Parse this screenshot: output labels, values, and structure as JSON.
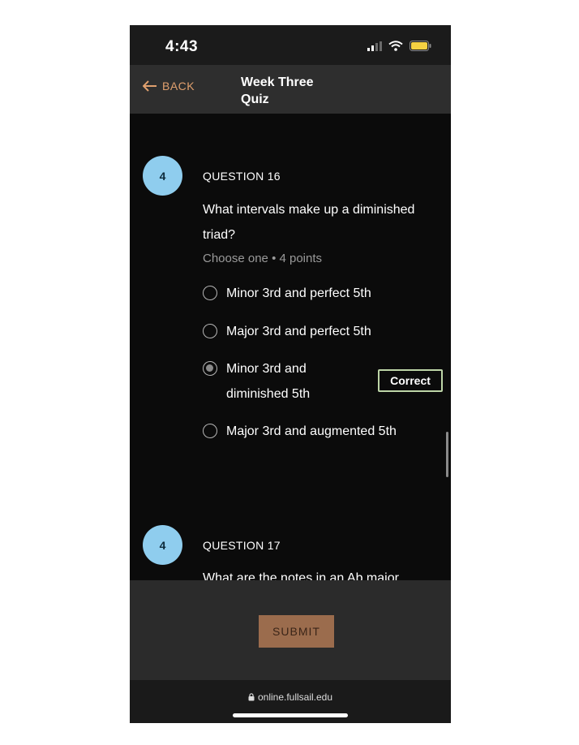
{
  "status_bar": {
    "time": "4:43"
  },
  "nav": {
    "back_label": "BACK",
    "title": "Week Three Quiz"
  },
  "questions": [
    {
      "badge": "4",
      "number": "QUESTION 16",
      "text": "What intervals make up a diminished triad?",
      "meta": "Choose one • 4 points",
      "options": [
        {
          "label": "Minor 3rd and perfect 5th",
          "selected": false
        },
        {
          "label": "Major 3rd and perfect 5th",
          "selected": false
        },
        {
          "label": "Minor 3rd and diminished 5th",
          "selected": true
        },
        {
          "label": "Major 3rd and augmented 5th",
          "selected": false
        }
      ],
      "result": "Correct"
    },
    {
      "badge": "4",
      "number": "QUESTION 17",
      "text": "What are the notes in an Ab major"
    }
  ],
  "footer": {
    "submit_label": "SUBMIT"
  },
  "browser": {
    "url": "online.fullsail.edu"
  },
  "colors": {
    "accent": "#e0a06e",
    "badge": "#8fcdee",
    "submit_bg": "#9b6c4d",
    "correct_border": "#bdd5a7"
  },
  "icons": [
    "signal-icon",
    "wifi-icon",
    "battery-icon",
    "back-arrow-icon",
    "lock-icon"
  ]
}
